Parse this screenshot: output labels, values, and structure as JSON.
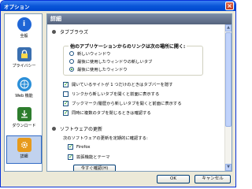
{
  "window": {
    "title": "オプション"
  },
  "sidebar": {
    "items": [
      {
        "label": "全般",
        "icon": "info-icon",
        "color": "#1f66d6"
      },
      {
        "label": "プライバシー",
        "icon": "privacy-icon",
        "color": "#3a6fb0"
      },
      {
        "label": "Web 機能",
        "icon": "web-features-icon",
        "color": "#2b8fd8"
      },
      {
        "label": "ダウンロード",
        "icon": "download-icon",
        "color": "#2d7d2d"
      },
      {
        "label": "詳細",
        "icon": "gear-icon",
        "color": "#e79a1b"
      }
    ],
    "selected_index": 4
  },
  "panel": {
    "header": "詳細",
    "tab_browsing": {
      "title": "タブブラウズ",
      "group_title": "他のアプリケーションからのリンクは次の場所に開く:",
      "radios": [
        {
          "label": "新しいウィンドウ",
          "checked": false
        },
        {
          "label": "最後に使用したウィンドウの新しいタブ",
          "checked": false
        },
        {
          "label": "最後に使用したウィンドウ",
          "checked": true
        }
      ],
      "checkboxes": [
        {
          "label": "開いているサイトが 1 つだけのときはタブバーを隠す",
          "checked": true
        },
        {
          "label": "リンクから新しいタブを開くと前面に表示する",
          "checked": false
        },
        {
          "label": "ブックマーク/履歴から新しいタブを開くと前面に表示する",
          "checked": true
        },
        {
          "label": "同時に複数のタブを閉じるときは確認する",
          "checked": true
        }
      ]
    },
    "software_update": {
      "title": "ソフトウェアの更新",
      "description": "次のソフトウェアの更新を定期的に確認する:",
      "checkboxes": [
        {
          "label": "Firefox",
          "checked": true
        },
        {
          "label": "拡張機能とテーマ",
          "checked": true
        }
      ],
      "check_now_button": "今すぐ確認(H)"
    }
  },
  "buttons": {
    "ok": "OK",
    "cancel": "キャンセル"
  }
}
